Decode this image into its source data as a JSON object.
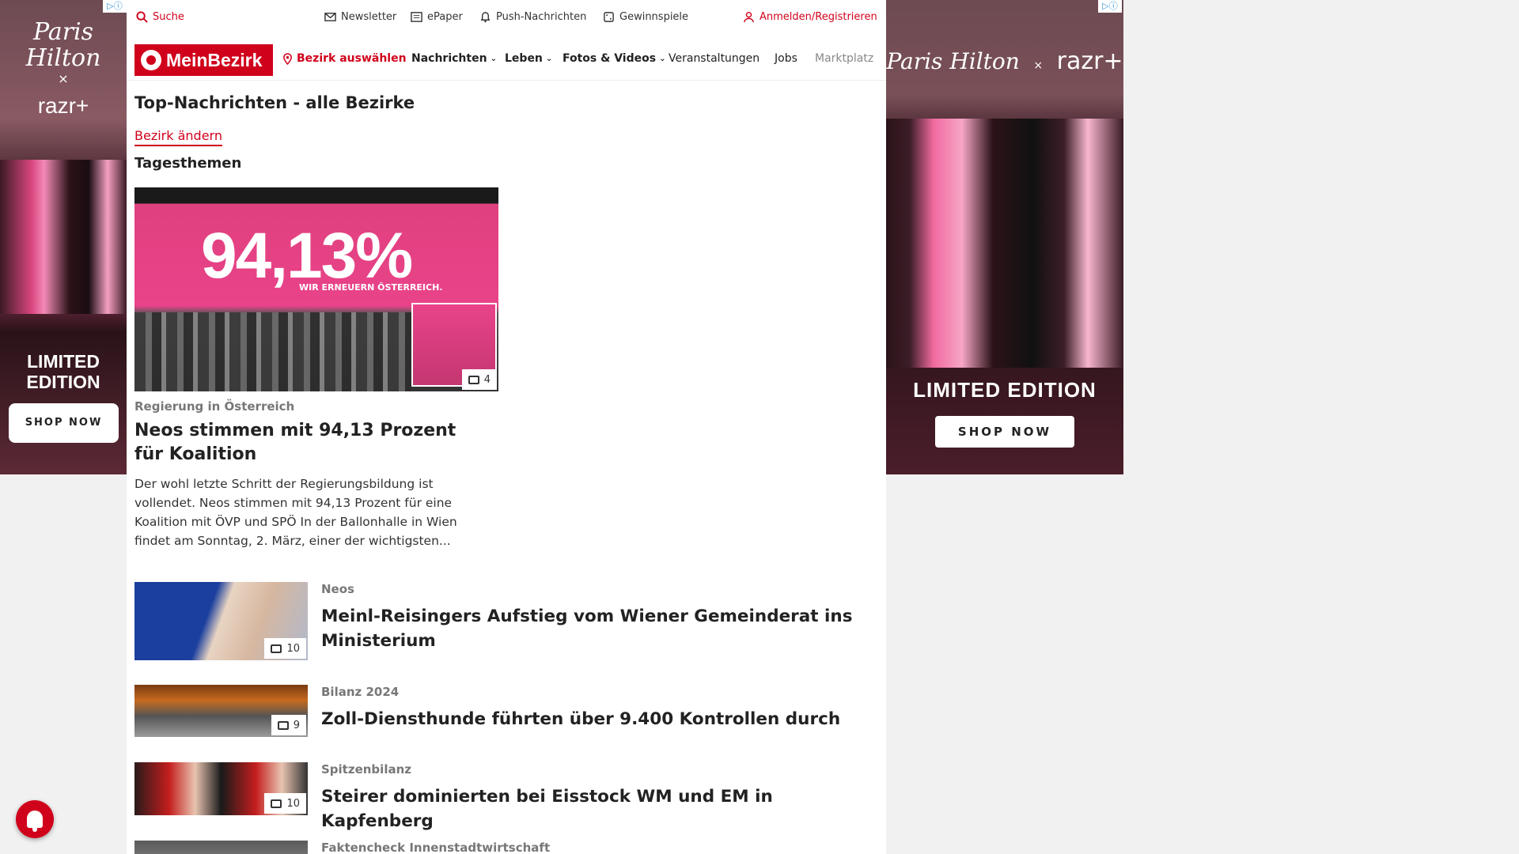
{
  "topbar": {
    "search": "Suche",
    "newsletter": "Newsletter",
    "epaper": "ePaper",
    "push": "Push-Nachrichten",
    "gewinnspiele": "Gewinnspiele",
    "login": "Anmelden/Registrieren"
  },
  "nav": {
    "logo": "MeinBezirk",
    "bezirk": "Bezirk auswählen",
    "items": [
      "Nachrichten",
      "Leben",
      "Fotos & Videos",
      "Veranstaltungen",
      "Jobs",
      "Marktplatz"
    ]
  },
  "page": {
    "title": "Top-Nachrichten - alle Bezirke",
    "change_link": "Bezirk ändern",
    "section": "Tagesthemen"
  },
  "hero": {
    "image_text": "94,13%",
    "image_subtext": "WIR ERNEUERN ÖSTERREICH.",
    "image_count": "4",
    "category": "Regierung in Österreich",
    "title": "Neos stimmen mit 94,13 Prozent für Koalition",
    "teaser": "Der wohl letzte Schritt der Regierungsbildung ist vollendet. Neos stimmen mit 94,13 Prozent für eine Koalition mit ÖVP und SPÖ In der Ballonhalle in Wien findet am Sonntag, 2. März, einer der wichtigsten..."
  },
  "articles": [
    {
      "category": "Neos",
      "title": "Meinl-Reisingers Aufstieg vom Wiener Gemeinderat ins Ministerium",
      "image_count": "10"
    },
    {
      "category": "Bilanz 2024",
      "title": "Zoll-Diensthunde führten über 9.400 Kontrollen durch",
      "image_count": "9"
    },
    {
      "category": "Spitzenbilanz",
      "title": "Steirer dominierten bei Eisstock WM und EM in Kapfenberg",
      "image_count": "10"
    },
    {
      "category": "Faktencheck Innenstadtwirtschaft",
      "title": "",
      "image_count": ""
    }
  ],
  "ads": {
    "left": {
      "brand": "Paris Hilton",
      "x": "×",
      "razr": "razr+",
      "limited": "LIMITED EDITION",
      "shop": "SHOP NOW"
    },
    "right": {
      "brand": "Paris Hilton",
      "x": "×",
      "razr": "razr+",
      "limited": "LIMITED EDITION",
      "shop": "SHOP NOW"
    }
  },
  "colors": {
    "brand_red": "#d0021b"
  }
}
